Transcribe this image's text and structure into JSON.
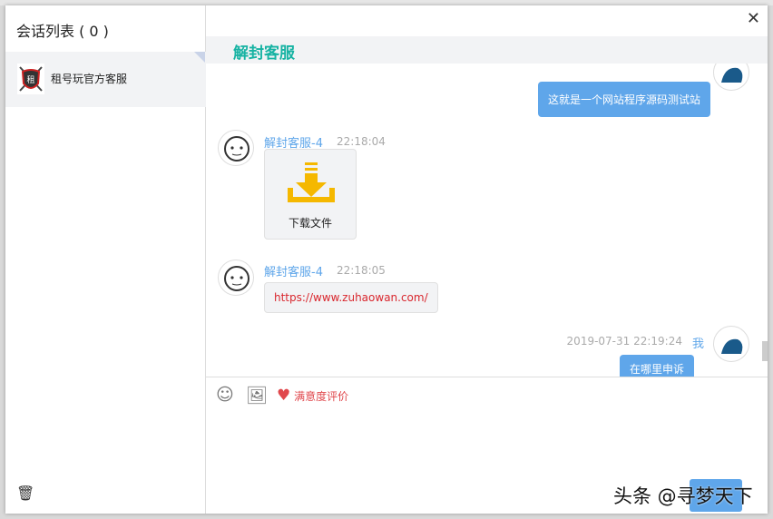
{
  "left": {
    "title": "会话列表 ( 0 )",
    "conversations": [
      {
        "name": "租号玩官方客服"
      }
    ]
  },
  "header": {
    "title": "解封客服"
  },
  "messages": [
    {
      "from": "me",
      "text": "这就是一个网站程序源码测试站"
    },
    {
      "from": "agent",
      "name": "解封客服-4",
      "time": "22:18:04",
      "file_label": "下载文件"
    },
    {
      "from": "agent",
      "name": "解封客服-4",
      "time": "22:18:05",
      "text": "https://www.zuhaowan.com/"
    },
    {
      "from": "me",
      "name": "我",
      "time": "2019-07-31 22:19:24",
      "text": "在哪里申诉"
    }
  ],
  "toolbar": {
    "rating_label": "满意度评价"
  },
  "watermark": "头条 @寻梦天下",
  "colors": {
    "accent": "#17b3a3",
    "bubble": "#5fa6ea",
    "link": "#d9272e"
  }
}
